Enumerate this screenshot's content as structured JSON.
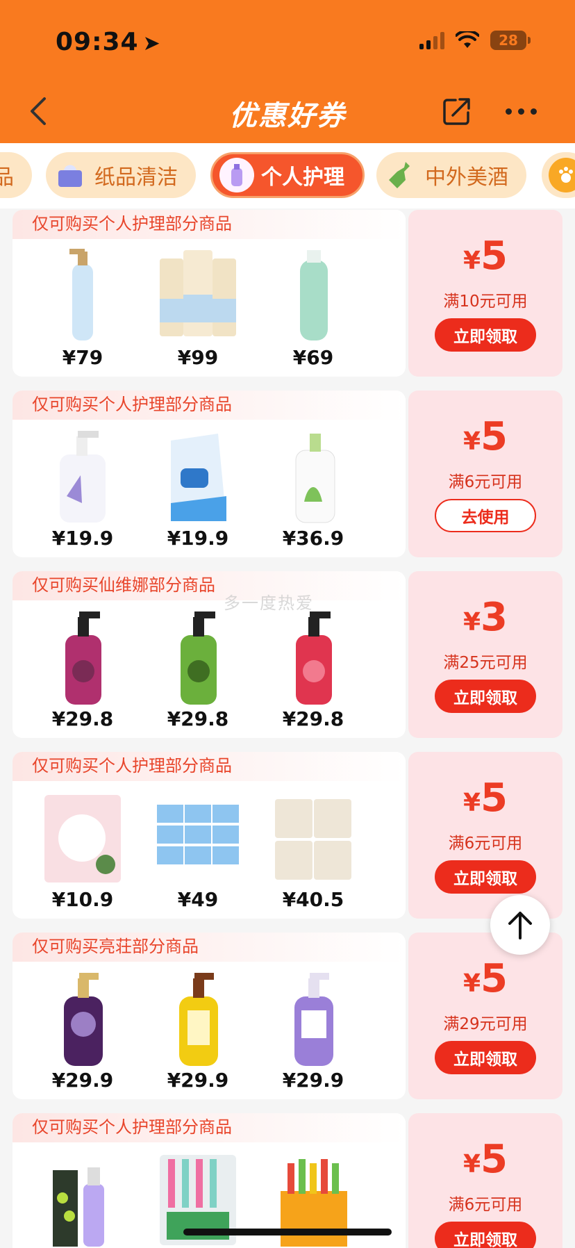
{
  "status_bar": {
    "time": "09:34",
    "battery": "28"
  },
  "nav": {
    "title": "优惠好券"
  },
  "tabs": [
    {
      "label": "品",
      "icon": "category-icon",
      "active": false
    },
    {
      "label": "纸品清洁",
      "icon": "tissue-box-icon",
      "active": false
    },
    {
      "label": "个人护理",
      "icon": "personal-care-icon",
      "active": true
    },
    {
      "label": "中外美酒",
      "icon": "wine-bottle-icon",
      "active": false
    },
    {
      "label": "",
      "icon": "pet-icon",
      "active": false
    }
  ],
  "coupons": [
    {
      "title": "仅可购买个人护理部分商品",
      "amount": "5",
      "condition": "满10元可用",
      "button": "立即领取",
      "button_style": "filled",
      "products": [
        {
          "price": "¥79",
          "icon": "pantene-bottle-icon"
        },
        {
          "price": "¥99",
          "icon": "pantene-tubes-icon"
        },
        {
          "price": "¥69",
          "icon": "head-shoulders-bottle-icon"
        }
      ]
    },
    {
      "title": "仅可购买个人护理部分商品",
      "amount": "5",
      "condition": "满6元可用",
      "button": "去使用",
      "button_style": "outline",
      "products": [
        {
          "price": "¥19.9",
          "icon": "hand-wash-bottle-icon"
        },
        {
          "price": "¥19.9",
          "icon": "safeguard-refill-icon"
        },
        {
          "price": "¥36.9",
          "icon": "body-wash-bottle-icon"
        }
      ]
    },
    {
      "title": "仅可购买仙维娜部分商品",
      "amount": "3",
      "condition": "满25元可用",
      "button": "立即领取",
      "button_style": "filled",
      "products": [
        {
          "price": "¥29.8",
          "icon": "purple-pump-bottle-icon"
        },
        {
          "price": "¥29.8",
          "icon": "green-pump-bottle-icon"
        },
        {
          "price": "¥29.8",
          "icon": "red-pump-bottle-icon"
        }
      ]
    },
    {
      "title": "仅可购买个人护理部分商品",
      "amount": "5",
      "condition": "满6元可用",
      "button": "立即领取",
      "button_style": "filled",
      "products": [
        {
          "price": "¥10.9",
          "icon": "sanitary-pad-pack-icon"
        },
        {
          "price": "¥49",
          "icon": "sanitary-pad-boxes-icon"
        },
        {
          "price": "¥40.5",
          "icon": "tissue-packs-icon"
        }
      ]
    },
    {
      "title": "仅可购买亮荘部分商品",
      "amount": "5",
      "condition": "满29元可用",
      "button": "立即领取",
      "button_style": "filled",
      "products": [
        {
          "price": "¥29.9",
          "icon": "dark-purple-bottle-icon"
        },
        {
          "price": "¥29.9",
          "icon": "yellow-bottle-icon"
        },
        {
          "price": "¥29.9",
          "icon": "lavender-bottle-icon"
        }
      ]
    },
    {
      "title": "仅可购买个人护理部分商品",
      "amount": "5",
      "condition": "满6元可用",
      "button": "立即领取",
      "button_style": "filled",
      "products": [
        {
          "price": "",
          "icon": "toothpaste-spray-icon"
        },
        {
          "price": "",
          "icon": "toothbrush-pack-icon"
        },
        {
          "price": "",
          "icon": "toothbrush-box-icon"
        }
      ]
    }
  ],
  "watermark": "多一度热爱",
  "colors": {
    "header": "#f97a1f",
    "accent": "#ec2c1c",
    "coupon_bg": "#fde3e6"
  }
}
